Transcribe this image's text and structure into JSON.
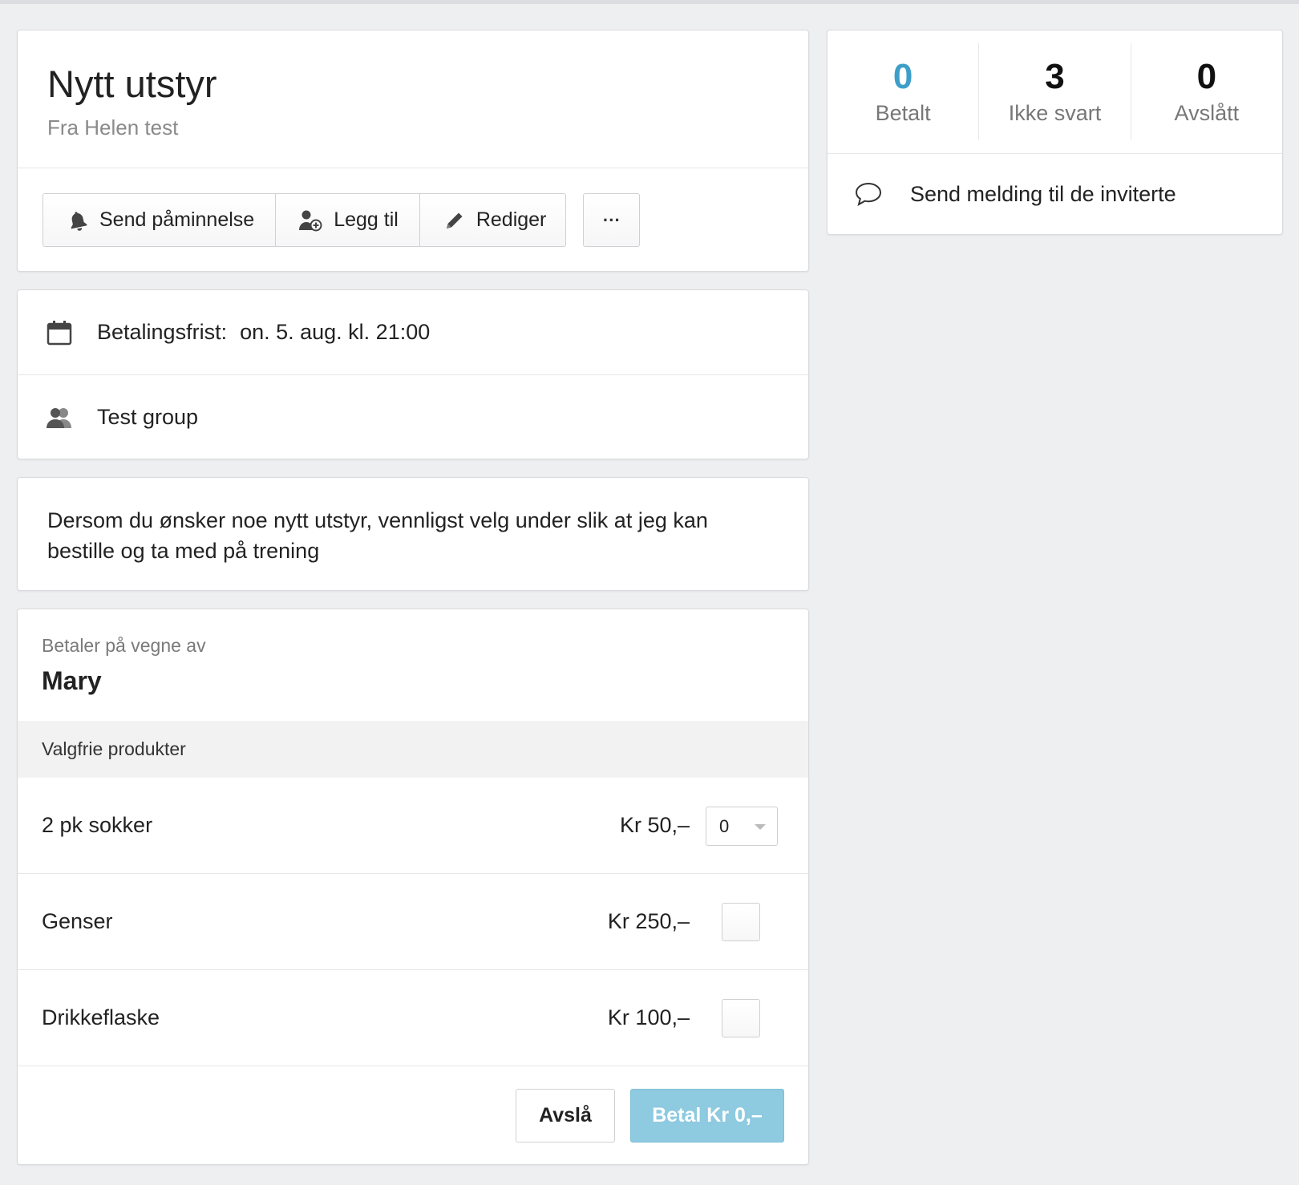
{
  "header": {
    "title": "Nytt utstyr",
    "subtitle": "Fra Helen test"
  },
  "toolbar": {
    "reminder_label": "Send påminnelse",
    "add_label": "Legg til",
    "edit_label": "Rediger",
    "more_label": "···"
  },
  "info": {
    "deadline_label": "Betalingsfrist:",
    "deadline_value": "on. 5. aug. kl. 21:00",
    "group": "Test group"
  },
  "description": "Dersom du ønsker noe nytt utstyr, vennligst velg under slik at jeg kan bestille og ta med på trening",
  "payment": {
    "payer_label": "Betaler på vegne av",
    "payer_name": "Mary",
    "section_title": "Valgfrie produkter",
    "products": [
      {
        "name": "2 pk sokker",
        "price": "Kr 50,–",
        "control": "select",
        "quantity": "0"
      },
      {
        "name": "Genser",
        "price": "Kr 250,–",
        "control": "checkbox",
        "checked": false
      },
      {
        "name": "Drikkeflaske",
        "price": "Kr 100,–",
        "control": "checkbox",
        "checked": false
      }
    ],
    "decline_label": "Avslå",
    "pay_label": "Betal Kr 0,–"
  },
  "stats": {
    "paid_count": "0",
    "paid_label": "Betalt",
    "unanswered_count": "3",
    "unanswered_label": "Ikke svart",
    "declined_count": "0",
    "declined_label": "Avslått"
  },
  "message": {
    "label": "Send melding til de inviterte"
  },
  "colors": {
    "accent": "#3d9fc9",
    "pay_button": "#8ecae0"
  }
}
